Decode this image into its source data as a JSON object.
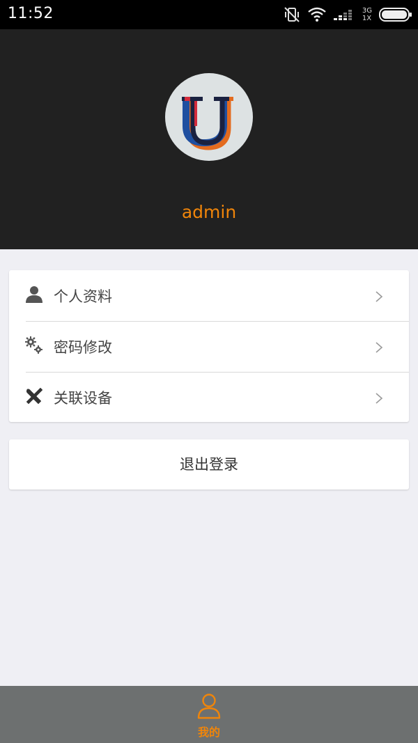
{
  "status_bar": {
    "time": "11:52",
    "network_top": "3G",
    "network_bottom": "1X"
  },
  "profile": {
    "username": "admin",
    "avatar_icon": "u-logo-icon"
  },
  "menu": {
    "items": [
      {
        "label": "个人资料",
        "icon": "user-icon"
      },
      {
        "label": "密码修改",
        "icon": "gears-icon"
      },
      {
        "label": "关联设备",
        "icon": "tools-icon"
      }
    ]
  },
  "logout": {
    "label": "退出登录"
  },
  "tab_bar": {
    "me_label": "我的"
  },
  "colors": {
    "accent": "#f0850a",
    "header_bg": "#212121",
    "page_bg": "#efeff4",
    "tab_bar_bg": "#6d7070"
  }
}
